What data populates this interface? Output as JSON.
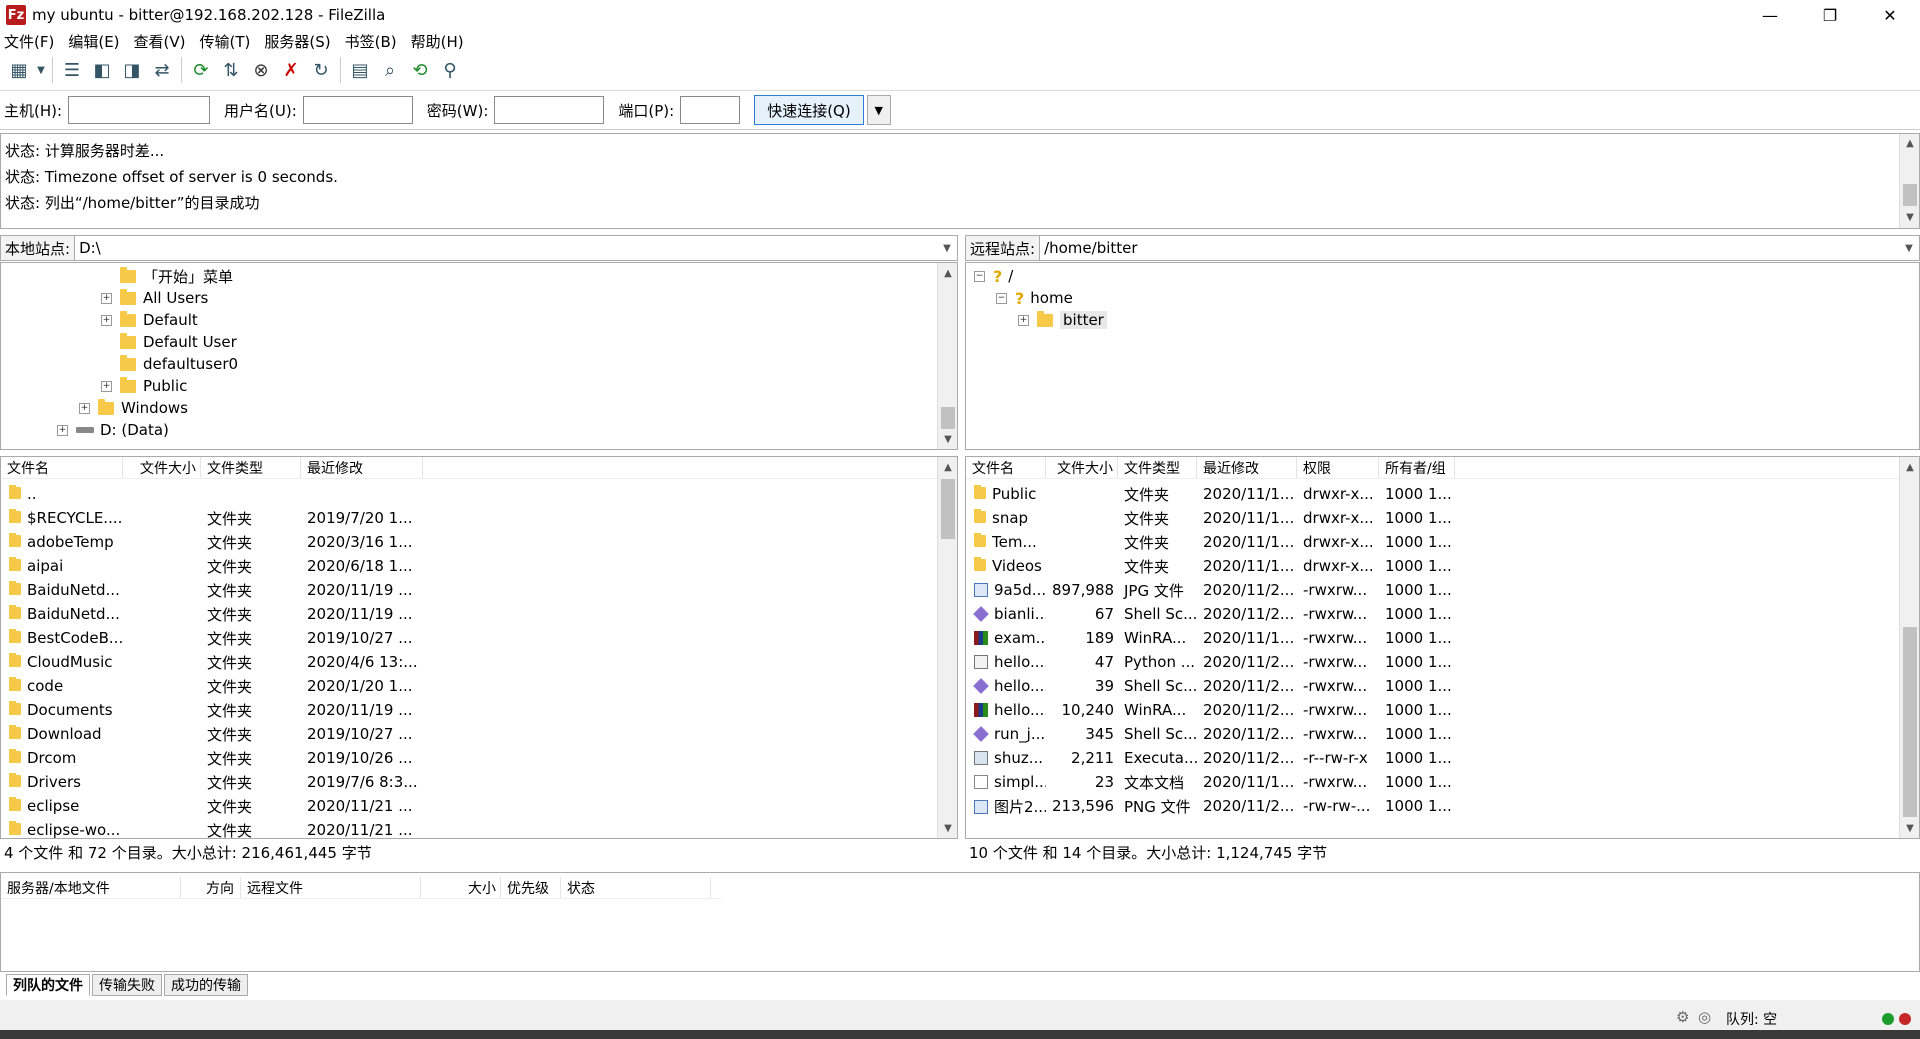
{
  "window": {
    "title": "my ubuntu - bitter@192.168.202.128 - FileZilla",
    "app_icon": "Fz",
    "min": "—",
    "max": "❐",
    "close": "✕"
  },
  "menu": [
    "文件(F)",
    "编辑(E)",
    "查看(V)",
    "传输(T)",
    "服务器(S)",
    "书签(B)",
    "帮助(H)"
  ],
  "toolbar_icons": [
    "site-manager-icon",
    "message-log-icon",
    "local-tree-icon",
    "remote-tree-icon",
    "transfer-queue-icon",
    "refresh-icon",
    "process-queue-icon",
    "cancel-icon",
    "disconnect-icon",
    "reconnect-icon",
    "filter-icon",
    "compare-icon",
    "sync-browse-icon",
    "search-icon"
  ],
  "quick": {
    "host_label": "主机(H):",
    "user_label": "用户名(U):",
    "pass_label": "密码(W):",
    "port_label": "端口(P):",
    "connect": "快速连接(Q)",
    "host_value": "",
    "user_value": "",
    "pass_value": "",
    "port_value": ""
  },
  "log": [
    "状态:  计算服务器时差...",
    "状态:  Timezone offset of server is 0 seconds.",
    "状态:  列出“/home/bitter”的目录成功"
  ],
  "local": {
    "site_label": "本地站点:",
    "path": "D:\\",
    "tree": [
      {
        "label": "「开始」菜单",
        "indent": 3,
        "expander": ""
      },
      {
        "label": "All Users",
        "indent": 3,
        "expander": "+"
      },
      {
        "label": "Default",
        "indent": 3,
        "expander": "+"
      },
      {
        "label": "Default User",
        "indent": 3,
        "expander": ""
      },
      {
        "label": "defaultuser0",
        "indent": 3,
        "expander": ""
      },
      {
        "label": "Public",
        "indent": 3,
        "expander": "+"
      },
      {
        "label": "Windows",
        "indent": 2,
        "expander": "+"
      },
      {
        "label": "D: (Data)",
        "indent": 1,
        "expander": "+",
        "drive": true
      }
    ],
    "columns": [
      "文件名",
      "文件大小",
      "文件类型",
      "最近修改"
    ],
    "files": [
      {
        "name": "..",
        "size": "",
        "type": "",
        "modified": ""
      },
      {
        "name": "$RECYCLE....",
        "size": "",
        "type": "文件夹",
        "modified": "2019/7/20 1..."
      },
      {
        "name": "adobeTemp",
        "size": "",
        "type": "文件夹",
        "modified": "2020/3/16 1..."
      },
      {
        "name": "aipai",
        "size": "",
        "type": "文件夹",
        "modified": "2020/6/18 1..."
      },
      {
        "name": "BaiduNetd...",
        "size": "",
        "type": "文件夹",
        "modified": "2020/11/19 ..."
      },
      {
        "name": "BaiduNetd...",
        "size": "",
        "type": "文件夹",
        "modified": "2020/11/19 ..."
      },
      {
        "name": "BestCodeB...",
        "size": "",
        "type": "文件夹",
        "modified": "2019/10/27 ..."
      },
      {
        "name": "CloudMusic",
        "size": "",
        "type": "文件夹",
        "modified": "2020/4/6 13:..."
      },
      {
        "name": "code",
        "size": "",
        "type": "文件夹",
        "modified": "2020/1/20 1..."
      },
      {
        "name": "Documents",
        "size": "",
        "type": "文件夹",
        "modified": "2020/11/19 ..."
      },
      {
        "name": "Download",
        "size": "",
        "type": "文件夹",
        "modified": "2019/10/27 ..."
      },
      {
        "name": "Drcom",
        "size": "",
        "type": "文件夹",
        "modified": "2019/10/26 ..."
      },
      {
        "name": "Drivers",
        "size": "",
        "type": "文件夹",
        "modified": "2019/7/6 8:3..."
      },
      {
        "name": "eclipse",
        "size": "",
        "type": "文件夹",
        "modified": "2020/11/21 ..."
      },
      {
        "name": "eclipse-wo...",
        "size": "",
        "type": "文件夹",
        "modified": "2020/11/21 ..."
      }
    ],
    "status": "4 个文件 和 72 个目录。大小总计: 216,461,445 字节"
  },
  "remote": {
    "site_label": "远程站点:",
    "path": "/home/bitter",
    "tree": [
      {
        "label": "/",
        "indent": 0,
        "expander": "−",
        "unknown": true
      },
      {
        "label": "home",
        "indent": 1,
        "expander": "−",
        "unknown": true
      },
      {
        "label": "bitter",
        "indent": 2,
        "expander": "+",
        "selected": true
      }
    ],
    "columns": [
      "文件名",
      "文件大小",
      "文件类型",
      "最近修改",
      "权限",
      "所有者/组"
    ],
    "files": [
      {
        "name": "Public",
        "size": "",
        "type": "文件夹",
        "modified": "2020/11/1...",
        "perm": "drwxr-x...",
        "owner": "1000 1...",
        "icon": "folder"
      },
      {
        "name": "snap",
        "size": "",
        "type": "文件夹",
        "modified": "2020/11/1...",
        "perm": "drwxr-x...",
        "owner": "1000 1...",
        "icon": "folder"
      },
      {
        "name": "Tem...",
        "size": "",
        "type": "文件夹",
        "modified": "2020/11/1...",
        "perm": "drwxr-x...",
        "owner": "1000 1...",
        "icon": "folder"
      },
      {
        "name": "Videos",
        "size": "",
        "type": "文件夹",
        "modified": "2020/11/1...",
        "perm": "drwxr-x...",
        "owner": "1000 1...",
        "icon": "folder"
      },
      {
        "name": "9a5d...",
        "size": "897,988",
        "type": "JPG 文件",
        "modified": "2020/11/2...",
        "perm": "-rwxrw...",
        "owner": "1000 1...",
        "icon": "image"
      },
      {
        "name": "bianli...",
        "size": "67",
        "type": "Shell Sc...",
        "modified": "2020/11/2...",
        "perm": "-rwxrw...",
        "owner": "1000 1...",
        "icon": "script"
      },
      {
        "name": "exam...",
        "size": "189",
        "type": "WinRA...",
        "modified": "2020/11/1...",
        "perm": "-rwxrw...",
        "owner": "1000 1...",
        "icon": "archive"
      },
      {
        "name": "hello....",
        "size": "47",
        "type": "Python ...",
        "modified": "2020/11/2...",
        "perm": "-rwxrw...",
        "owner": "1000 1...",
        "icon": "python"
      },
      {
        "name": "hello....",
        "size": "39",
        "type": "Shell Sc...",
        "modified": "2020/11/2...",
        "perm": "-rwxrw...",
        "owner": "1000 1...",
        "icon": "script"
      },
      {
        "name": "hello....",
        "size": "10,240",
        "type": "WinRA...",
        "modified": "2020/11/2...",
        "perm": "-rwxrw...",
        "owner": "1000 1...",
        "icon": "archive"
      },
      {
        "name": "run_j...",
        "size": "345",
        "type": "Shell Sc...",
        "modified": "2020/11/2...",
        "perm": "-rwxrw...",
        "owner": "1000 1...",
        "icon": "script"
      },
      {
        "name": "shuz...",
        "size": "2,211",
        "type": "Executa...",
        "modified": "2020/11/2...",
        "perm": "-r--rw-r-x",
        "owner": "1000 1...",
        "icon": "exec"
      },
      {
        "name": "simpl...",
        "size": "23",
        "type": "文本文档",
        "modified": "2020/11/1...",
        "perm": "-rwxrw...",
        "owner": "1000 1...",
        "icon": "text"
      },
      {
        "name": "图片2...",
        "size": "213,596",
        "type": "PNG 文件",
        "modified": "2020/11/2...",
        "perm": "-rw-rw-...",
        "owner": "1000 1...",
        "icon": "image"
      }
    ],
    "status": "10 个文件 和 14 个目录。大小总计: 1,124,745 字节"
  },
  "queue": {
    "columns": [
      "服务器/本地文件",
      "方向",
      "远程文件",
      "大小",
      "优先级",
      "状态"
    ],
    "tabs": [
      "列队的文件",
      "传输失败",
      "成功的传输"
    ],
    "status": "队列: 空"
  }
}
